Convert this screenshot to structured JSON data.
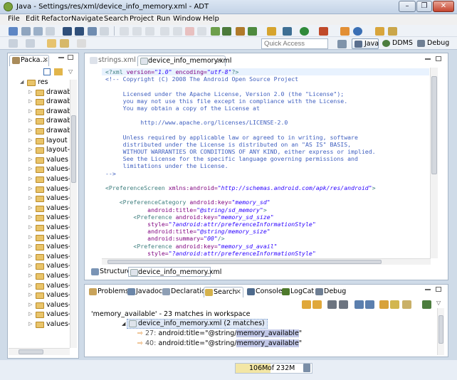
{
  "window": {
    "title": "Java - Settings/res/xml/device_info_memory.xml - ADT"
  },
  "menu": [
    "File",
    "Edit",
    "Refactor",
    "Navigate",
    "Search",
    "Project",
    "Run",
    "Window",
    "Help"
  ],
  "quick_access": {
    "placeholder": "Quick Access"
  },
  "perspectives": [
    "Java",
    "DDMS",
    "Debug"
  ],
  "package_explorer": {
    "tab_label": "Packa...",
    "items": [
      {
        "label": "res",
        "expanded": true
      },
      {
        "label": "drawab"
      },
      {
        "label": "drawab"
      },
      {
        "label": "drawab"
      },
      {
        "label": "drawab"
      },
      {
        "label": "drawab"
      },
      {
        "label": "layout"
      },
      {
        "label": "layout-"
      },
      {
        "label": "values"
      },
      {
        "label": "values-"
      },
      {
        "label": "values-"
      },
      {
        "label": "values-"
      },
      {
        "label": "values-"
      },
      {
        "label": "values-"
      },
      {
        "label": "values-"
      },
      {
        "label": "values-"
      },
      {
        "label": "values-"
      },
      {
        "label": "values-"
      },
      {
        "label": "values-"
      },
      {
        "label": "values-"
      },
      {
        "label": "values-"
      },
      {
        "label": "values-"
      },
      {
        "label": "values-"
      },
      {
        "label": "values-"
      },
      {
        "label": "values-"
      },
      {
        "label": "values-"
      }
    ]
  },
  "editor": {
    "tabs": [
      {
        "label": "strings.xml",
        "active": false
      },
      {
        "label": "device_info_memory.xml",
        "active": true
      }
    ],
    "lines": [
      [
        {
          "t": "<?xml ",
          "c": "pi"
        },
        {
          "t": "version=",
          "c": "attr"
        },
        {
          "t": "\"1.0\" ",
          "c": "val"
        },
        {
          "t": "encoding=",
          "c": "attr"
        },
        {
          "t": "\"utf-8\"",
          "c": "val"
        },
        {
          "t": "?>",
          "c": "pi"
        }
      ],
      [
        {
          "t": "<!-- Copyright (C) 2008 The Android Open Source Project",
          "c": "cm"
        }
      ],
      [
        {
          "t": "",
          "c": "cm"
        }
      ],
      [
        {
          "t": "     Licensed under the Apache License, Version 2.0 (the \"License\");",
          "c": "cm"
        }
      ],
      [
        {
          "t": "     you may not use this file except in compliance with the License.",
          "c": "cm"
        }
      ],
      [
        {
          "t": "     You may obtain a copy of the License at",
          "c": "cm"
        }
      ],
      [
        {
          "t": "",
          "c": "cm"
        }
      ],
      [
        {
          "t": "          http://www.apache.org/licenses/LICENSE-2.0",
          "c": "cm"
        }
      ],
      [
        {
          "t": "",
          "c": "cm"
        }
      ],
      [
        {
          "t": "     Unless required by applicable law or agreed to in writing, software",
          "c": "cm"
        }
      ],
      [
        {
          "t": "     distributed under the License is distributed on an \"AS IS\" BASIS,",
          "c": "cm"
        }
      ],
      [
        {
          "t": "     WITHOUT WARRANTIES OR CONDITIONS OF ANY KIND, either express or implied.",
          "c": "cm"
        }
      ],
      [
        {
          "t": "     See the License for the specific language governing permissions and",
          "c": "cm"
        }
      ],
      [
        {
          "t": "     limitations under the License.",
          "c": "cm"
        }
      ],
      [
        {
          "t": "-->",
          "c": "cm"
        }
      ],
      [
        {
          "t": "",
          "c": "cm"
        }
      ],
      [
        {
          "t": "<PreferenceScreen ",
          "c": "tag"
        },
        {
          "t": "xmlns:android=",
          "c": "attr"
        },
        {
          "t": "\"http://schemas.android.com/apk/res/android\"",
          "c": "val"
        },
        {
          "t": ">",
          "c": "tag"
        }
      ],
      [
        {
          "t": "",
          "c": "cm"
        }
      ],
      [
        {
          "t": "    <PreferenceCategory ",
          "c": "tag"
        },
        {
          "t": "android:key=",
          "c": "attr"
        },
        {
          "t": "\"memory_sd\"",
          "c": "val"
        }
      ],
      [
        {
          "t": "            android:title=",
          "c": "attr"
        },
        {
          "t": "\"@string/sd_memory\"",
          "c": "val"
        },
        {
          "t": ">",
          "c": "tag"
        }
      ],
      [
        {
          "t": "        <Preference ",
          "c": "tag"
        },
        {
          "t": "android:key=",
          "c": "attr"
        },
        {
          "t": "\"memory_sd_size\"",
          "c": "val"
        }
      ],
      [
        {
          "t": "            style=",
          "c": "attr"
        },
        {
          "t": "\"?android:attr/preferenceInformationStyle\"",
          "c": "val"
        }
      ],
      [
        {
          "t": "            android:title=",
          "c": "attr"
        },
        {
          "t": "\"@string/memory_size\"",
          "c": "val"
        }
      ],
      [
        {
          "t": "            android:summary=",
          "c": "attr"
        },
        {
          "t": "\"00\"",
          "c": "val"
        },
        {
          "t": "/>",
          "c": "tag"
        }
      ],
      [
        {
          "t": "        <Preference ",
          "c": "tag"
        },
        {
          "t": "android:key=",
          "c": "attr"
        },
        {
          "t": "\"memory_sd_avail\"",
          "c": "val"
        }
      ],
      [
        {
          "t": "            style=",
          "c": "attr"
        },
        {
          "t": "\"?android:attr/preferenceInformationStyle\"",
          "c": "val"
        }
      ]
    ],
    "bottom_tabs": [
      {
        "label": "Structure"
      },
      {
        "label": "device_info_memory.xml"
      }
    ]
  },
  "bottom_panel": {
    "tabs": [
      "Problems",
      "Javadoc",
      "Declaration",
      "Search",
      "Console",
      "LogCat",
      "Debug"
    ],
    "summary": "'memory_available' - 23 matches in workspace",
    "file_result": "device_info_memory.xml (2 matches)",
    "matches": [
      {
        "line": "27:",
        "prefix": "android:title=\"@string/",
        "match": "memory_available",
        "suffix": "\""
      },
      {
        "line": "40:",
        "prefix": "android:title=\"@string/",
        "match": "memory_available",
        "suffix": "\""
      }
    ]
  },
  "heap": {
    "used": "106M",
    "of": "of",
    "total": "232M",
    "fraction": 0.457
  },
  "colors": {
    "accent": "#3f5fbf",
    "highlight": "#c3c9e9",
    "heap_fill": "#f3e6a5"
  }
}
